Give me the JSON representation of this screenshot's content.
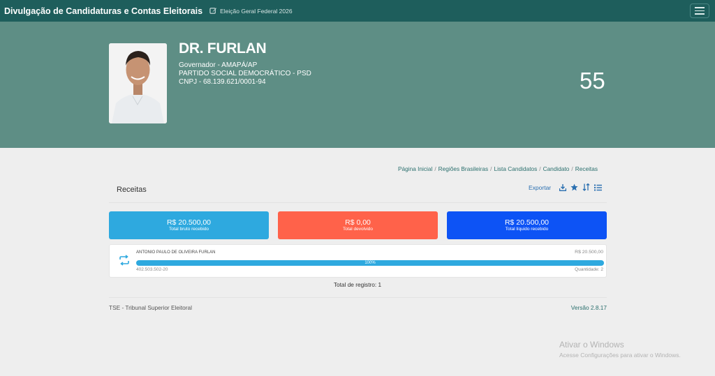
{
  "app": {
    "title": "Divulgação de Candidaturas e Contas Eleitorais",
    "election": "Eleição Geral Federal 2026"
  },
  "candidate": {
    "name": "DR. FURLAN",
    "office": "Governador - AMAPÁ/AP",
    "party": "PARTIDO SOCIAL DEMOCRÁTICO - PSD",
    "cnpj": "CNPJ - 68.139.621/0001-94",
    "number": "55"
  },
  "breadcrumb": [
    "Página Inicial",
    "Regiões Brasileiras",
    "Lista Candidatos",
    "Candidato",
    "Receitas"
  ],
  "section": {
    "title": "Receitas",
    "export_label": "Exportar"
  },
  "cards": {
    "bruto": {
      "amount": "R$ 20.500,00",
      "label": "Total bruto recebido",
      "color": "#2ea9df"
    },
    "devolvido": {
      "amount": "R$ 0,00",
      "label": "Total devolvido",
      "color": "#ff624a"
    },
    "liquido": {
      "amount": "R$ 20.500,00",
      "label": "Total líquido recebido",
      "color": "#0d53f5"
    }
  },
  "receipts": [
    {
      "donor": "ANTONIO PAULO DE OLIVEIRA FURLAN",
      "amount": "R$ 20.500,00",
      "percent_label": "100%",
      "percent": 100,
      "document": "402.503.502-20",
      "quantity": "Quantidade: 2"
    }
  ],
  "total_records": "Total de registro: 1",
  "footer": {
    "org": "TSE - Tribunal Superior Eleitoral",
    "version": "Versão 2.8.17"
  },
  "watermark": {
    "line1": "Ativar o Windows",
    "line2": "Acesse Configurações para ativar o Windows."
  }
}
